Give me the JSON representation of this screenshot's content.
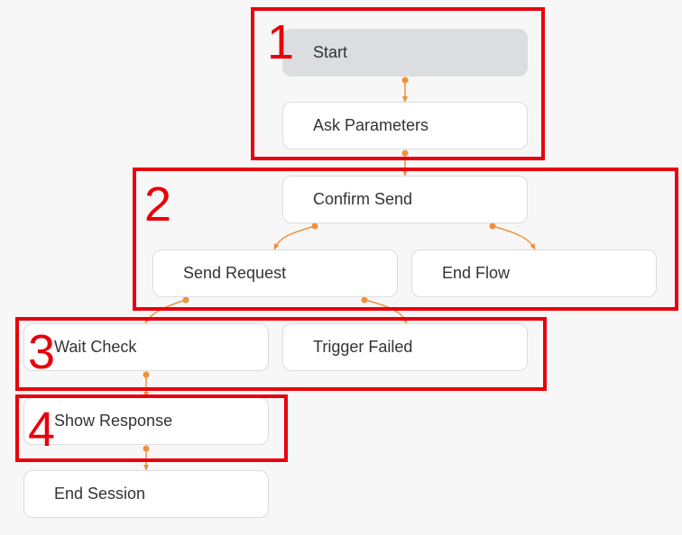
{
  "colors": {
    "edge": "#f0913a",
    "highlight": "#e8000b",
    "node_border": "#dadce0",
    "start_fill": "#dcdde0"
  },
  "nodes": {
    "start": "Start",
    "ask_parameters": "Ask Parameters",
    "confirm_send": "Confirm Send",
    "send_request": "Send Request",
    "end_flow": "End Flow",
    "wait_check": "Wait Check",
    "trigger_failed": "Trigger Failed",
    "show_response": "Show Response",
    "end_session": "End Session"
  },
  "edges": [
    [
      "start",
      "ask_parameters"
    ],
    [
      "ask_parameters",
      "confirm_send"
    ],
    [
      "confirm_send",
      "send_request"
    ],
    [
      "confirm_send",
      "end_flow"
    ],
    [
      "send_request",
      "wait_check"
    ],
    [
      "send_request",
      "trigger_failed"
    ],
    [
      "wait_check",
      "show_response"
    ],
    [
      "show_response",
      "end_session"
    ]
  ],
  "groups": [
    {
      "label": "1",
      "nodes": [
        "start",
        "ask_parameters"
      ]
    },
    {
      "label": "2",
      "nodes": [
        "confirm_send",
        "send_request",
        "end_flow"
      ]
    },
    {
      "label": "3",
      "nodes": [
        "wait_check",
        "trigger_failed"
      ]
    },
    {
      "label": "4",
      "nodes": [
        "show_response"
      ]
    }
  ]
}
